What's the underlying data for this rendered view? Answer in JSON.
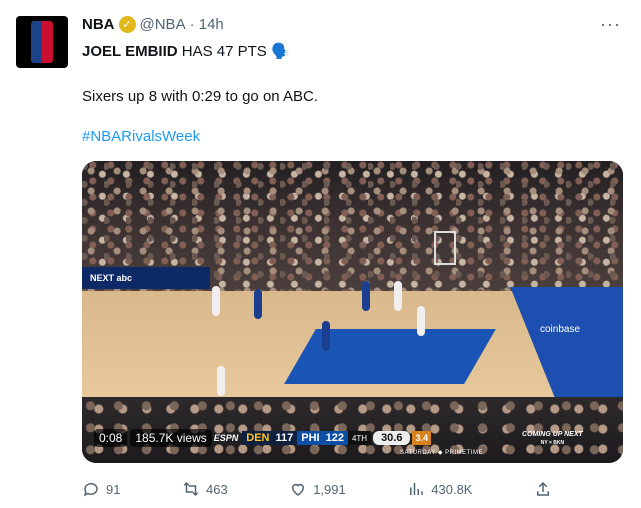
{
  "tweet": {
    "name": "NBA",
    "handle": "@NBA",
    "time": "· 14h",
    "line1_bold": "JOEL EMBIID",
    "line1_rest": " HAS 47 PTS 🗣️",
    "line2": "Sixers up 8 with 0:29 to go on ABC.",
    "hashtag": "#NBARivalsWeek"
  },
  "video": {
    "time_elapsed": "0:08",
    "views": "185.7K views",
    "network": "ESPN",
    "away_team": "DEN",
    "away_score": "117",
    "home_team": "PHI",
    "home_score": "122",
    "quarter": "4TH",
    "clock": "30.6",
    "shot_clock": "3.4",
    "promo_text": "SATURDAY ◆ PRIMETIME",
    "coming_up": "COMING UP NEXT",
    "coming_up_matchup": "NY × BKN",
    "court_sponsor": "coinbase",
    "table_text": "NEXT abc"
  },
  "actions": {
    "replies": "91",
    "retweets": "463",
    "likes": "1,991",
    "views": "430.8K"
  },
  "colors": {
    "link": "#1d9bf0",
    "muted": "#536471",
    "verified": "#e2b719"
  }
}
